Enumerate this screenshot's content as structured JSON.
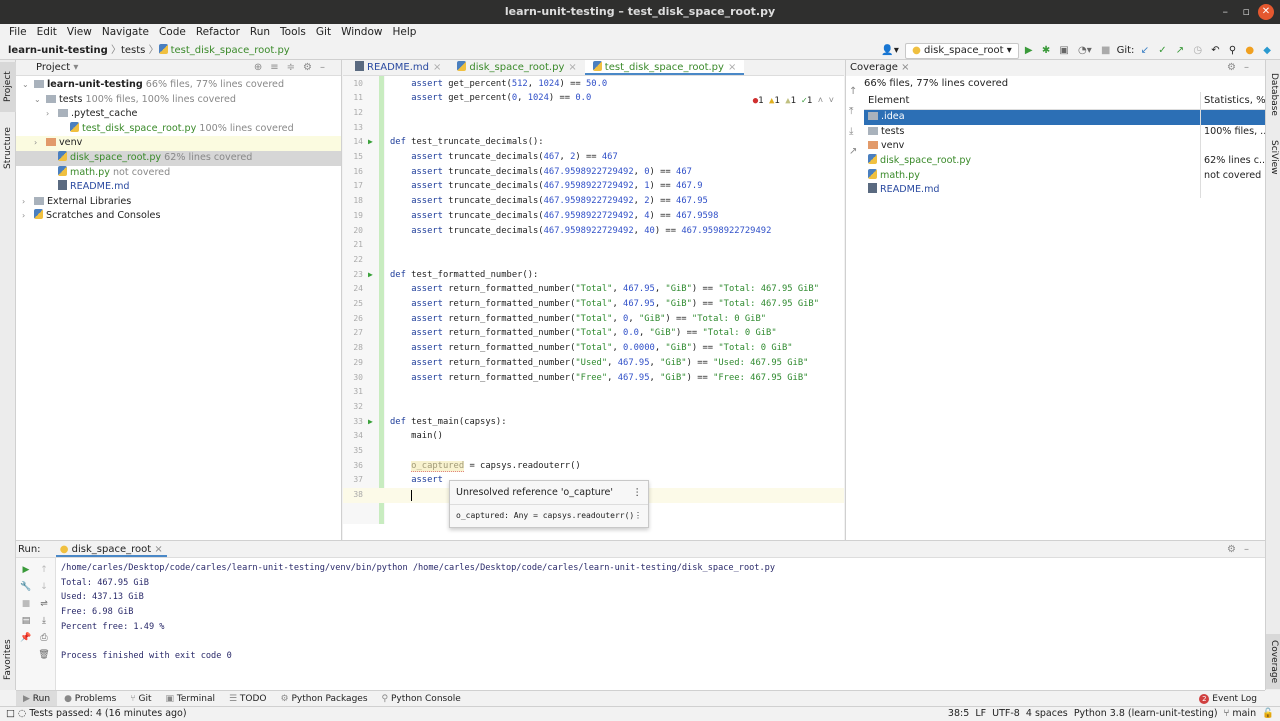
{
  "window": {
    "title": "learn-unit-testing – test_disk_space_root.py"
  },
  "menu": [
    "File",
    "Edit",
    "View",
    "Navigate",
    "Code",
    "Refactor",
    "Run",
    "Tools",
    "Git",
    "Window",
    "Help"
  ],
  "breadcrumb": {
    "project": "learn-unit-testing",
    "folder": "tests",
    "file": "test_disk_space_root.py"
  },
  "toolbar": {
    "run_config": "disk_space_root",
    "git_label": "Git:"
  },
  "left_stripe": {
    "project": "Project",
    "structure": "Structure",
    "favorites": "Favorites"
  },
  "right_stripe": {
    "database": "Database",
    "sciview": "SciView",
    "coverage": "Coverage"
  },
  "project_panel": {
    "title": "Project",
    "tree": [
      {
        "name": "learn-unit-testing",
        "note": "66% files, 77% lines covered",
        "type": "folder",
        "level": 0,
        "arrow": "v",
        "bold": true
      },
      {
        "name": "tests",
        "note": "100% files, 100% lines covered",
        "type": "folder",
        "level": 1,
        "arrow": "v"
      },
      {
        "name": ".pytest_cache",
        "note": "",
        "type": "folder",
        "level": 2,
        "arrow": ">"
      },
      {
        "name": "test_disk_space_root.py",
        "note": "100% lines covered",
        "type": "py",
        "level": 3,
        "arrow": ""
      },
      {
        "name": "venv",
        "note": "",
        "type": "folder-orange",
        "level": 1,
        "arrow": ">",
        "highlight": "yellow"
      },
      {
        "name": "disk_space_root.py",
        "note": "62% lines covered",
        "type": "py",
        "level": 2,
        "arrow": "",
        "highlight": "gray"
      },
      {
        "name": "math.py",
        "note": "not covered",
        "type": "py",
        "level": 2,
        "arrow": ""
      },
      {
        "name": "README.md",
        "note": "",
        "type": "md",
        "level": 2,
        "arrow": ""
      },
      {
        "name": "External Libraries",
        "note": "",
        "type": "lib",
        "level": 0,
        "arrow": ">"
      },
      {
        "name": "Scratches and Consoles",
        "note": "",
        "type": "scratch",
        "level": 0,
        "arrow": ">"
      }
    ]
  },
  "editor": {
    "tabs": [
      {
        "label": "README.md",
        "active": false
      },
      {
        "label": "disk_space_root.py",
        "active": false
      },
      {
        "label": "test_disk_space_root.py",
        "active": true
      }
    ],
    "inspections": {
      "errors": "1",
      "warnings": "1",
      "weak_warnings": "1",
      "typos": "1"
    },
    "lines": [
      {
        "n": "10",
        "text": "    assert get_percent(512, 1024) == 50.0"
      },
      {
        "n": "11",
        "text": "    assert get_percent(0, 1024) == 0.0"
      },
      {
        "n": "12",
        "text": ""
      },
      {
        "n": "13",
        "text": ""
      },
      {
        "n": "14",
        "text": "def test_truncate_decimals():",
        "run": true
      },
      {
        "n": "15",
        "text": "    assert truncate_decimals(467, 2) == 467"
      },
      {
        "n": "16",
        "text": "    assert truncate_decimals(467.9598922729492, 0) == 467"
      },
      {
        "n": "17",
        "text": "    assert truncate_decimals(467.9598922729492, 1) == 467.9"
      },
      {
        "n": "18",
        "text": "    assert truncate_decimals(467.9598922729492, 2) == 467.95"
      },
      {
        "n": "19",
        "text": "    assert truncate_decimals(467.9598922729492, 4) == 467.9598"
      },
      {
        "n": "20",
        "text": "    assert truncate_decimals(467.9598922729492, 40) == 467.9598922729492"
      },
      {
        "n": "21",
        "text": ""
      },
      {
        "n": "22",
        "text": ""
      },
      {
        "n": "23",
        "text": "def test_formatted_number():",
        "run": true
      },
      {
        "n": "24",
        "text": "    assert return_formatted_number(\"Total\", 467.95, \"GiB\") == \"Total: 467.95 GiB\""
      },
      {
        "n": "25",
        "text": "    assert return_formatted_number(\"Total\", 467.95, \"GiB\") == \"Total: 467.95 GiB\""
      },
      {
        "n": "26",
        "text": "    assert return_formatted_number(\"Total\", 0, \"GiB\") == \"Total: 0 GiB\""
      },
      {
        "n": "27",
        "text": "    assert return_formatted_number(\"Total\", 0.0, \"GiB\") == \"Total: 0 GiB\""
      },
      {
        "n": "28",
        "text": "    assert return_formatted_number(\"Total\", 0.0000, \"GiB\") == \"Total: 0 GiB\""
      },
      {
        "n": "29",
        "text": "    assert return_formatted_number(\"Used\", 467.95, \"GiB\") == \"Used: 467.95 GiB\""
      },
      {
        "n": "30",
        "text": "    assert return_formatted_number(\"Free\", 467.95, \"GiB\") == \"Free: 467.95 GiB\""
      },
      {
        "n": "31",
        "text": ""
      },
      {
        "n": "32",
        "text": ""
      },
      {
        "n": "33",
        "text": "def test_main(capsys):",
        "run": true
      },
      {
        "n": "34",
        "text": "    main()"
      },
      {
        "n": "35",
        "text": ""
      },
      {
        "n": "36",
        "text": "    o_captured = capsys.readouterr()"
      },
      {
        "n": "37",
        "text": "    assert"
      },
      {
        "n": "38",
        "text": "    "
      }
    ],
    "tooltip": {
      "message": "Unresolved reference 'o_capture'",
      "quickdoc": "o_captured: Any = capsys.readouterr()"
    }
  },
  "coverage_panel": {
    "title": "Coverage",
    "summary": "66% files, 77% lines covered",
    "columns": [
      "Element",
      "Statistics, %"
    ],
    "rows": [
      {
        "name": ".idea",
        "stat": "",
        "type": "folder",
        "selected": true
      },
      {
        "name": "tests",
        "stat": "100% files, ...",
        "type": "folder"
      },
      {
        "name": "venv",
        "stat": "",
        "type": "folder-orange"
      },
      {
        "name": "disk_space_root.py",
        "stat": "62% lines c...",
        "type": "py"
      },
      {
        "name": "math.py",
        "stat": "not covered",
        "type": "py"
      },
      {
        "name": "README.md",
        "stat": "",
        "type": "md"
      }
    ]
  },
  "run_panel": {
    "label": "Run:",
    "tab": "disk_space_root",
    "output": [
      "/home/carles/Desktop/code/carles/learn-unit-testing/venv/bin/python /home/carles/Desktop/code/carles/learn-unit-testing/disk_space_root.py",
      "Total: 467.95 GiB",
      "Used: 437.13 GiB",
      "Free: 6.98 GiB",
      "Percent free: 1.49 %",
      "",
      "Process finished with exit code 0"
    ]
  },
  "bottom_tabs": [
    "Run",
    "Problems",
    "Git",
    "Terminal",
    "TODO",
    "Python Packages",
    "Python Console"
  ],
  "event_log": {
    "label": "Event Log",
    "count": "2"
  },
  "status": {
    "message": "Tests passed: 4 (16 minutes ago)",
    "position": "38:5",
    "line_sep": "LF",
    "encoding": "UTF-8",
    "indent": "4 spaces",
    "interpreter": "Python 3.8 (learn-unit-testing)",
    "branch": "main"
  }
}
